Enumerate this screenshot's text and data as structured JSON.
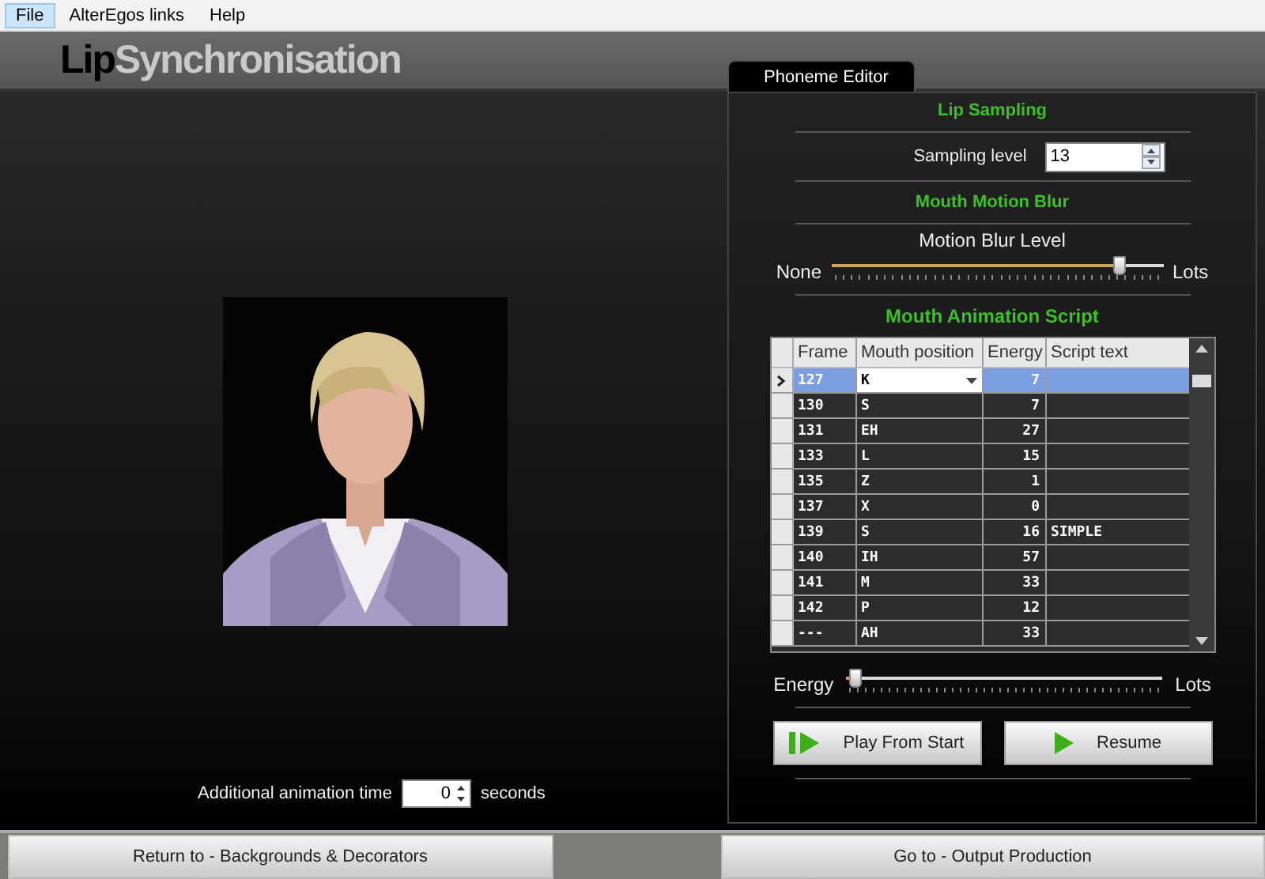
{
  "menu": [
    {
      "label": "File",
      "selected": true
    },
    {
      "label": "AlterEgos links",
      "selected": false
    },
    {
      "label": "Help",
      "selected": false
    }
  ],
  "logo_parts": [
    "Lip",
    "Synchronisation"
  ],
  "viewport": {
    "kind": "picture",
    "extra_time_label": "Additional animation time",
    "extra_time_value": "0",
    "extra_time_unit": "seconds"
  },
  "tabs": [
    {
      "label": "Phoneme Editor",
      "selected": true
    }
  ],
  "lip_sampling": {
    "heading": "Lip Sampling",
    "label": "Sampling level",
    "value": "13"
  },
  "motion_blur": {
    "heading": "Mouth Motion Blur",
    "label": "Motion Blur Level",
    "min_label": "None",
    "max_label": "Lots",
    "level": 0.87
  },
  "script": {
    "heading": "Mouth Animation Script",
    "columns": [
      "Frame",
      "Mouth position",
      "Energy",
      "Script text"
    ],
    "rows": [
      {
        "frame": "127",
        "position": "K",
        "energy": "7",
        "text": "",
        "selected": true
      },
      {
        "frame": "130",
        "position": "S",
        "energy": "7",
        "selected": false
      },
      {
        "frame": "131",
        "position": "EH",
        "energy": "27",
        "selected": false
      },
      {
        "frame": "133",
        "position": "L",
        "energy": "15",
        "selected": false
      },
      {
        "frame": "135",
        "position": "Z",
        "energy": "1",
        "selected": false
      },
      {
        "frame": "137",
        "position": "X",
        "energy": "0",
        "selected": false
      },
      {
        "frame": "139",
        "position": "S",
        "energy": "16",
        "text": "SIMPLE",
        "selected": false
      },
      {
        "frame": "140",
        "position": "IH",
        "energy": "57",
        "selected": false
      },
      {
        "frame": "141",
        "position": "M",
        "energy": "33",
        "selected": false
      },
      {
        "frame": "142",
        "position": "P",
        "energy": "12",
        "selected": false
      },
      {
        "frame": "---",
        "position": "AH",
        "energy": "33",
        "selected": false
      }
    ]
  },
  "energy": {
    "label": "Energy",
    "max_label": "Lots",
    "level": 0.03
  },
  "play_buttons": [
    {
      "kind": "start",
      "label": "Play From Start"
    },
    {
      "kind": "resume",
      "label": "Resume"
    }
  ],
  "nav_buttons": [
    "Return to - Backgrounds & Decorators",
    "Go to - Output Production"
  ]
}
